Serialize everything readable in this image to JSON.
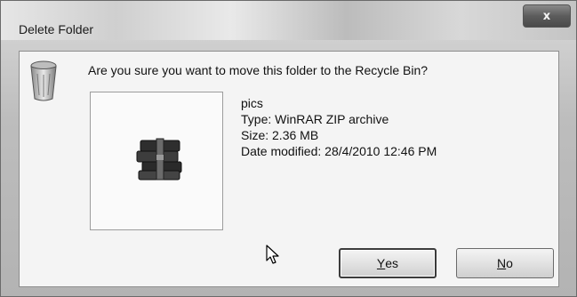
{
  "window": {
    "title": "Delete Folder",
    "close_glyph": "x"
  },
  "dialog": {
    "question": "Are you sure you want to move this folder to the Recycle Bin?",
    "icon": "recycle-bin-icon",
    "item": {
      "name": "pics",
      "type": "Type: WinRAR ZIP archive",
      "size": "Size: 2.36 MB",
      "date_modified": "Date modified: 28/4/2010 12:46 PM",
      "icon": "winrar-archive-icon"
    }
  },
  "buttons": {
    "yes_mnemonic": "Y",
    "yes_rest": "es",
    "no_mnemonic": "N",
    "no_rest": "o"
  }
}
